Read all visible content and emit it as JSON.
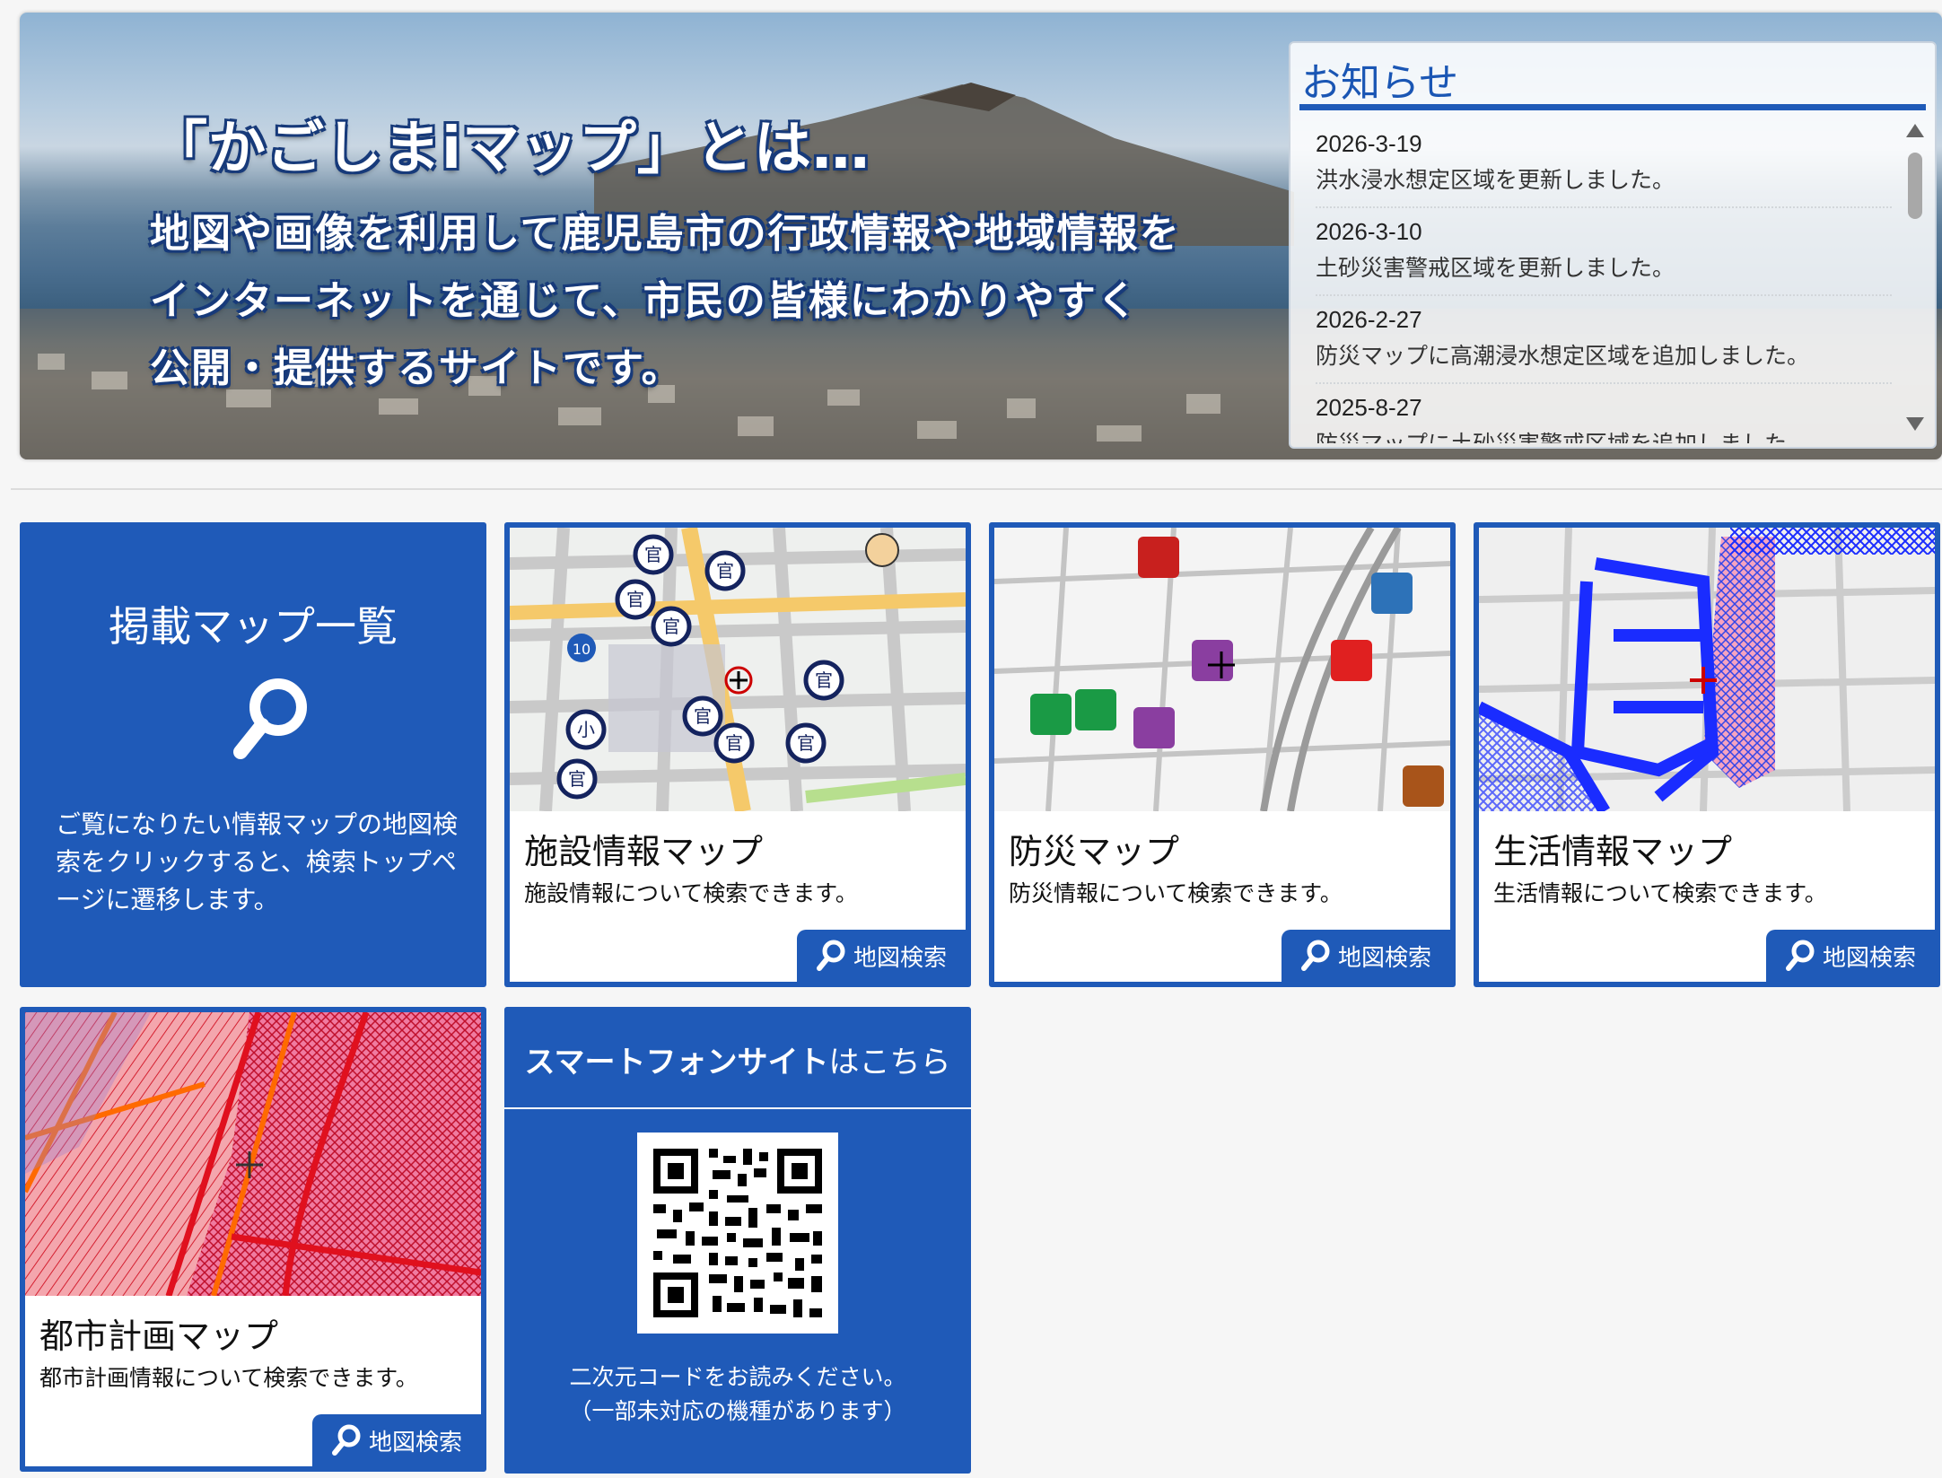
{
  "hero": {
    "title": "「かごしまiマップ」とは…",
    "line1": "地図や画像を利用して鹿児島市の行政情報や地域情報を",
    "line2": "インターネットを通じて、市民の皆様にわかりやすく",
    "line3": "公開・提供するサイトです。"
  },
  "news": {
    "title": "お知らせ",
    "items": [
      {
        "date": "2026-3-19",
        "text": "洪水浸水想定区域を更新しました。"
      },
      {
        "date": "2026-3-10",
        "text": "土砂災害警戒区域を更新しました。"
      },
      {
        "date": "2026-2-27",
        "text": "防災マップに高潮浸水想定区域を追加しました。"
      },
      {
        "date": "2025-8-27",
        "text": "防災マップに土砂災害警戒区域を追加しました。"
      }
    ]
  },
  "map_list": {
    "title": "掲載マップ一覧",
    "icon": "search-icon",
    "description": "ご覧になりたい情報マップの地図検索をクリックすると、検索トップページに遷移します。"
  },
  "maps": [
    {
      "title": "施設情報マップ",
      "description": "施設情報について検索できます。",
      "button": "地図検索"
    },
    {
      "title": "防災マップ",
      "description": "防災情報について検索できます。",
      "button": "地図検索"
    },
    {
      "title": "生活情報マップ",
      "description": "生活情報について検索できます。",
      "button": "地図検索"
    },
    {
      "title": "都市計画マップ",
      "description": "都市計画情報について検索できます。",
      "button": "地図検索"
    }
  ],
  "smartphone": {
    "title_bold": "スマートフォンサイト",
    "title_rest": "はこちら",
    "note_line1": "二次元コードをお読みください。",
    "note_line2": "（一部未対応の機種があります）"
  },
  "colors": {
    "brand_blue": "#1f5ab8",
    "background": "#f6f6f6"
  }
}
